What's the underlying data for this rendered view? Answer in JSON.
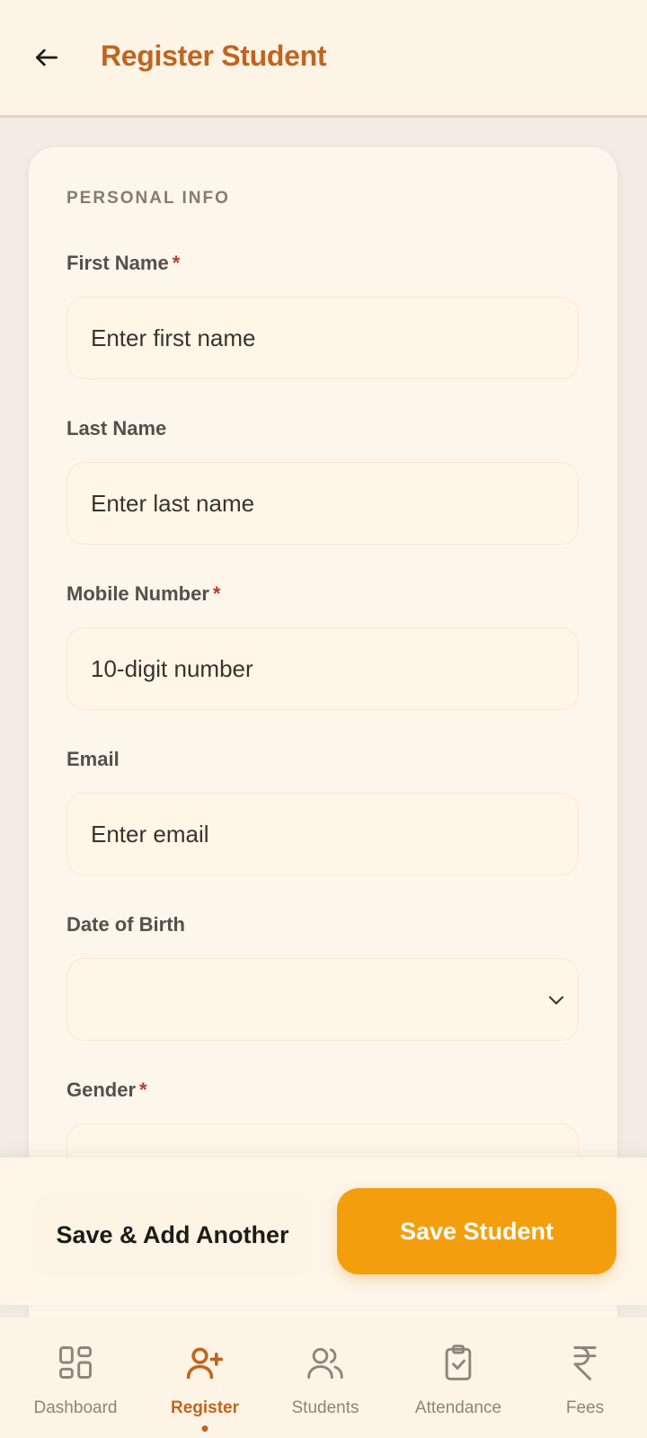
{
  "header": {
    "title": "Register Student",
    "back_icon": "arrow-left-icon"
  },
  "form": {
    "section_title": "PERSONAL INFO",
    "required_mark": "*",
    "first_name": {
      "label": "First Name",
      "placeholder": "Enter first name"
    },
    "last_name": {
      "label": "Last Name",
      "placeholder": "Enter last name"
    },
    "mobile": {
      "label": "Mobile Number",
      "placeholder": "10-digit number"
    },
    "email": {
      "label": "Email",
      "placeholder": "Enter email"
    },
    "dob": {
      "label": "Date of Birth"
    },
    "gender": {
      "label": "Gender"
    }
  },
  "actions": {
    "save_add_another": "Save & Add Another",
    "save_student": "Save Student"
  },
  "nav": {
    "items": [
      {
        "label": "Dashboard",
        "icon": "grid-icon"
      },
      {
        "label": "Register",
        "icon": "user-plus-icon",
        "active": true
      },
      {
        "label": "Students",
        "icon": "users-icon"
      },
      {
        "label": "Attendance",
        "icon": "clipboard-check-icon"
      },
      {
        "label": "Fees",
        "icon": "rupee-icon"
      }
    ]
  },
  "colors": {
    "accent": "#c0651f",
    "primary_button": "#f39f0d",
    "required": "#c0392b",
    "background": "#fdf4e6"
  }
}
